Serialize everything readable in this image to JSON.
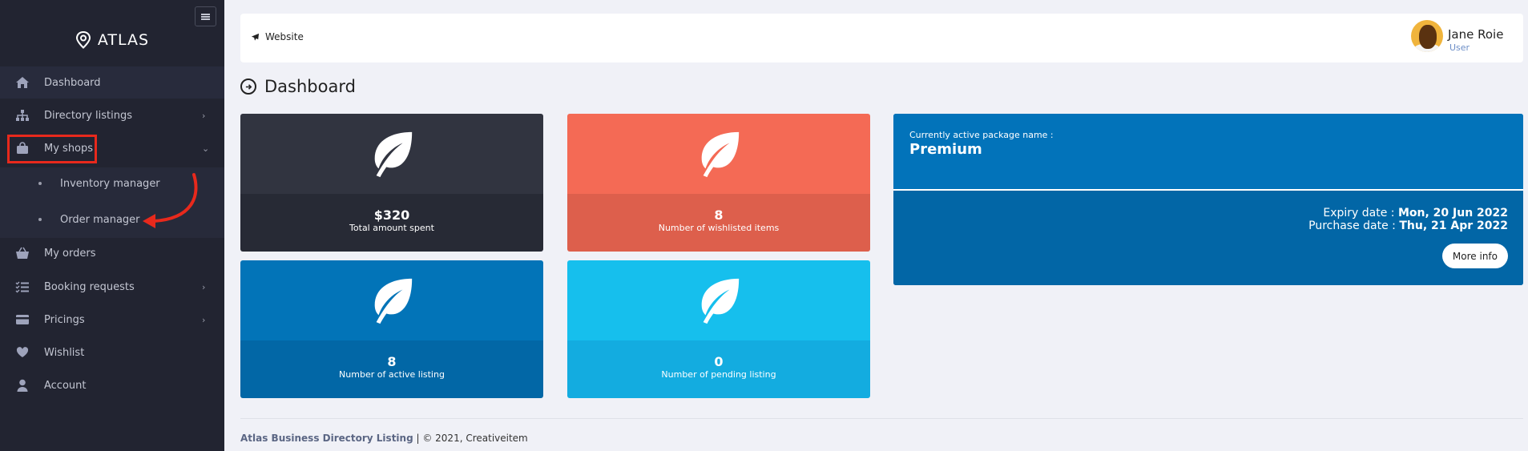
{
  "brand": {
    "name": "ATLAS"
  },
  "sidebar": {
    "items": [
      {
        "label": "Dashboard",
        "icon": "home-icon"
      },
      {
        "label": "Directory listings",
        "icon": "sitemap-icon",
        "chevron": "›"
      },
      {
        "label": "My shops",
        "icon": "shopping-bag-icon",
        "chevron": "⌄"
      },
      {
        "label": "My orders",
        "icon": "basket-icon"
      },
      {
        "label": "Booking requests",
        "icon": "checklist-icon",
        "chevron": "›"
      },
      {
        "label": "Pricings",
        "icon": "credit-card-icon",
        "chevron": "›"
      },
      {
        "label": "Wishlist",
        "icon": "heart-icon"
      },
      {
        "label": "Account",
        "icon": "user-icon"
      }
    ],
    "sub_items": [
      {
        "label": "Inventory manager"
      },
      {
        "label": "Order manager"
      }
    ]
  },
  "topbar": {
    "website_label": "Website",
    "user_name": "Jane Roie",
    "user_role": "User"
  },
  "page": {
    "title": "Dashboard"
  },
  "stats": [
    {
      "value": "$320",
      "caption": "Total amount spent",
      "color_top": "#313440",
      "color_bottom": "#272a35"
    },
    {
      "value": "8",
      "caption": "Number of wishlisted items",
      "color_top": "#f46a55",
      "color_bottom": "#dd5f4c"
    },
    {
      "value": "8",
      "caption": "Number of active listing",
      "color_top": "#0274b8",
      "color_bottom": "#0267a6"
    },
    {
      "value": "0",
      "caption": "Number of pending listing",
      "color_top": "#16bfed",
      "color_bottom": "#13ace0"
    }
  ],
  "package": {
    "label": "Currently active package name :",
    "name": "Premium",
    "expiry_label": "Expiry date :",
    "expiry_value": "Mon, 20 Jun 2022",
    "purchase_label": "Purchase date :",
    "purchase_value": "Thu, 21 Apr 2022",
    "more_button": "More info"
  },
  "footer": {
    "brand": "Atlas Business Directory Listing",
    "rest": " | © 2021, Creativeitem"
  },
  "colors": {
    "sidebar_bg": "#222431",
    "highlight": "#e8291c",
    "accent_blue": "#0272b9"
  }
}
